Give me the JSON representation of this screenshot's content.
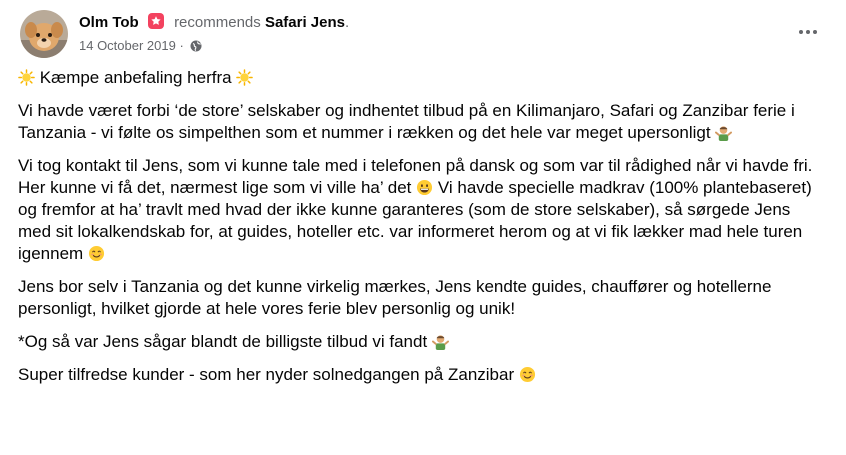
{
  "post": {
    "author": "Olm Tob",
    "verb": "recommends",
    "page_name": "Safari Jens",
    "page_suffix": ".",
    "date": "14 October 2019",
    "date_separator": " · "
  },
  "icons": {
    "avatar": "dog-avatar",
    "recommend": "recommend-badge-icon",
    "privacy": "globe-icon",
    "more": "more-options-icon"
  },
  "content": {
    "p1": "Kæmpe anbefaling herfra",
    "p2": "Vi havde været forbi ‘de store’ selskaber og indhentet tilbud på en Kilimanjaro, Safari og Zanzibar ferie i Tanzania - vi følte os simpelthen som et nummer i rækken og det hele var meget upersonligt",
    "p3a": "Vi tog kontakt til Jens, som vi kunne tale med i telefonen på dansk og som var til rådighed når vi havde fri. Her kunne vi få det, nærmest lige som vi ville ha’ det",
    "p3b": " Vi havde specielle madkrav (100% plantebaseret) og fremfor at ha’ travlt med hvad der ikke kunne garanteres (som de store selskaber), så sørgede Jens med sit lokalkendskab for, at guides, hoteller etc. var informeret herom og at vi fik lækker mad hele turen igennem",
    "p4": "Jens bor selv i Tanzania og det kunne virkelig mærkes, Jens kendte guides, chauffører og hotellerne personligt, hvilket gjorde at hele vores ferie blev personlig og unik!",
    "p5": "*Og så var Jens sågar blandt de billigste tilbud vi fandt",
    "p6": "Super tilfredse kunder - som her nyder solnedgangen på Zanzibar"
  },
  "colors": {
    "secondary_text": "#65676b",
    "badge": "#f3425f"
  }
}
